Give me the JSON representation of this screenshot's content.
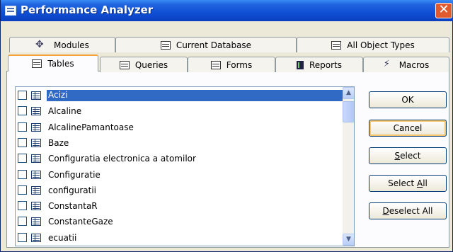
{
  "window": {
    "title": "Performance Analyzer",
    "close": "✕"
  },
  "tabs_back": [
    {
      "label": "Modules",
      "icon": "modules-icon"
    },
    {
      "label": "Current Database",
      "icon": "database-icon"
    },
    {
      "label": "All Object Types",
      "icon": "all-objects-icon"
    }
  ],
  "tabs_front": [
    {
      "label": "Tables",
      "icon": "table-icon"
    },
    {
      "label": "Queries",
      "icon": "query-icon"
    },
    {
      "label": "Forms",
      "icon": "form-icon"
    },
    {
      "label": "Reports",
      "icon": "report-icon"
    },
    {
      "label": "Macros",
      "icon": "macro-icon"
    }
  ],
  "objects": [
    "Acizi",
    "Alcaline",
    "AlcalinePamantoase",
    "Baze",
    "Configuratia electronica a atomilor",
    "Configuratie",
    "configuratii",
    "ConstantaR",
    "ConstanteGaze",
    "ecuatii"
  ],
  "selected_index": 0,
  "buttons": {
    "ok": "OK",
    "cancel": "Cancel",
    "select_first": "S",
    "select_rest": "elect",
    "select_all_first": "Select ",
    "select_all_u": "A",
    "select_all_rest": "ll",
    "deselect_all_u": "D",
    "deselect_all_rest": "eselect All"
  },
  "scroll": {
    "up": "▲",
    "down": "▼"
  }
}
